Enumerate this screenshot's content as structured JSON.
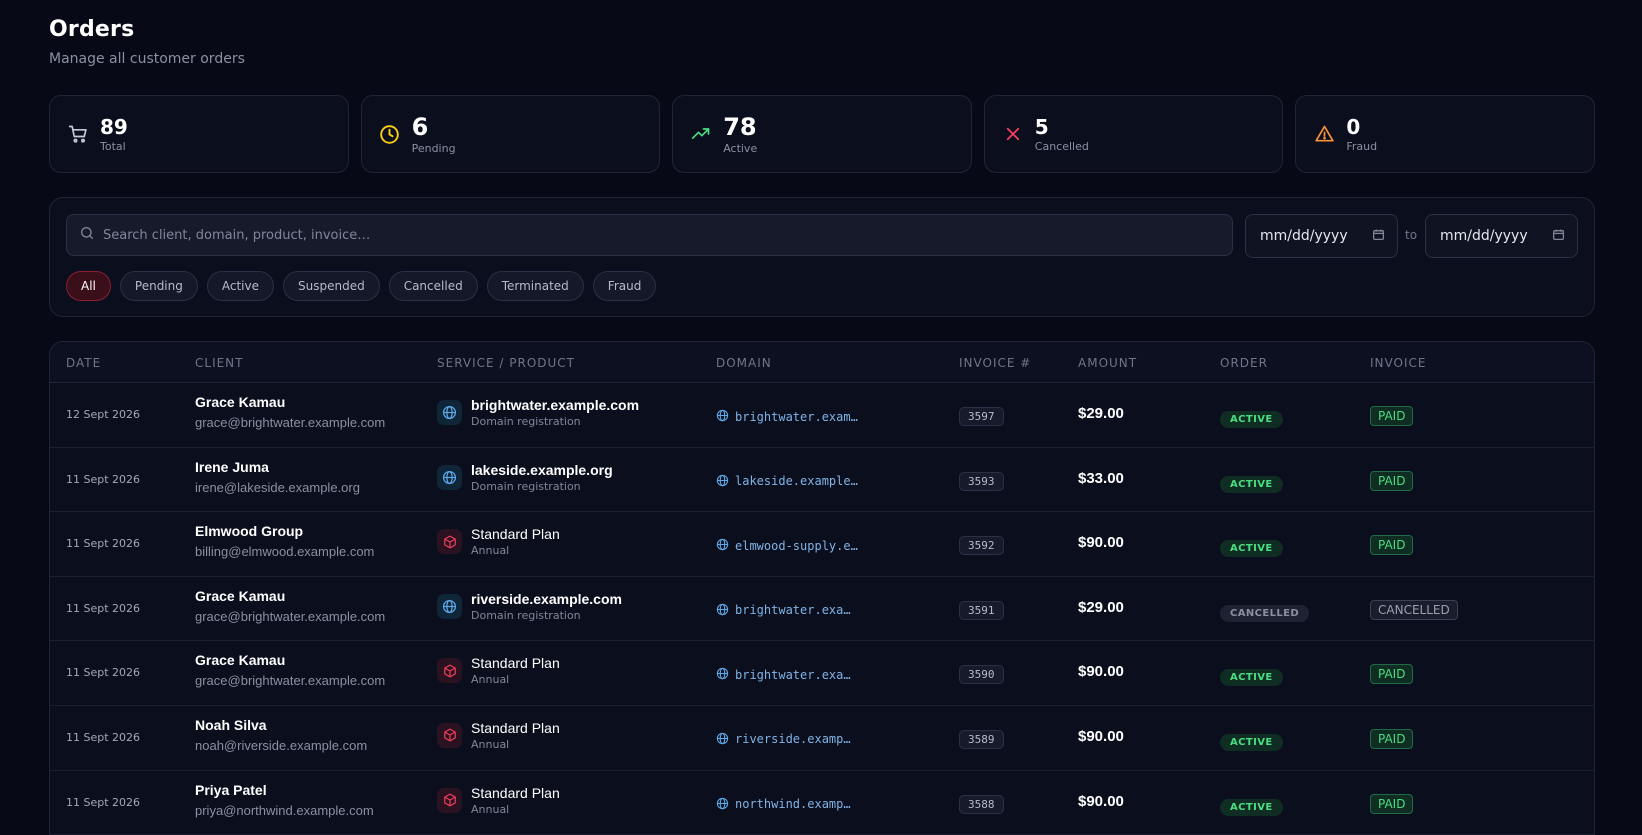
{
  "header": {
    "title": "Orders",
    "subtitle": "Manage all customer orders"
  },
  "stats": [
    {
      "value": "89",
      "label": "Total",
      "icon": "cart-icon",
      "color": "#c7cbd6"
    },
    {
      "value": "6",
      "label": "Pending",
      "icon": "clock-icon",
      "color": "#facc15"
    },
    {
      "value": "78",
      "label": "Active",
      "icon": "trending-up-icon",
      "color": "#4ade80"
    },
    {
      "value": "5",
      "label": "Cancelled",
      "icon": "x-icon",
      "color": "#f43f5e"
    },
    {
      "value": "0",
      "label": "Fraud",
      "icon": "warning-icon",
      "color": "#fb923c"
    }
  ],
  "filters": {
    "search_placeholder": "Search client, domain, product, invoice…",
    "date_from_placeholder": "mm/dd/yyyy",
    "date_to_placeholder": "mm/dd/yyyy",
    "date_separator": "to",
    "chips": [
      "All",
      "Pending",
      "Active",
      "Suspended",
      "Cancelled",
      "Terminated",
      "Fraud"
    ],
    "active_chip": "All"
  },
  "table": {
    "columns": [
      "DATE",
      "CLIENT",
      "SERVICE / PRODUCT",
      "DOMAIN",
      "INVOICE #",
      "AMOUNT",
      "ORDER",
      "INVOICE"
    ],
    "rows": [
      {
        "date": "12 Sept 2026",
        "client": "Grace Kamau",
        "email": "grace@brightwater.example.com",
        "service": "brightwater.example.com",
        "service_sub": "Domain registration",
        "type": "domain",
        "domain": "brightwater.exam…",
        "invoice": "3597",
        "amount": "$29.00",
        "order": "ACTIVE",
        "invoice_status": "PAID"
      },
      {
        "date": "11 Sept 2026",
        "client": "Irene Juma",
        "email": "irene@lakeside.example.org",
        "service": "lakeside.example.org",
        "service_sub": "Domain registration",
        "type": "domain",
        "domain": "lakeside.example…",
        "invoice": "3593",
        "amount": "$33.00",
        "order": "ACTIVE",
        "invoice_status": "PAID"
      },
      {
        "date": "11 Sept 2026",
        "client": "Elmwood Group",
        "email": "billing@elmwood.example.com",
        "service": "Standard Plan",
        "service_sub": "Annual",
        "type": "plan",
        "domain": "elmwood-supply.e…",
        "invoice": "3592",
        "amount": "$90.00",
        "order": "ACTIVE",
        "invoice_status": "PAID"
      },
      {
        "date": "11 Sept 2026",
        "client": "Grace Kamau",
        "email": "grace@brightwater.example.com",
        "service": "riverside.example.com",
        "service_sub": "Domain registration",
        "type": "domain",
        "domain": "brightwater.exa…",
        "invoice": "3591",
        "amount": "$29.00",
        "order": "CANCELLED",
        "invoice_status": "CANCELLED"
      },
      {
        "date": "11 Sept 2026",
        "client": "Grace Kamau",
        "email": "grace@brightwater.example.com",
        "service": "Standard Plan",
        "service_sub": "Annual",
        "type": "plan",
        "domain": "brightwater.exa…",
        "invoice": "3590",
        "amount": "$90.00",
        "order": "ACTIVE",
        "invoice_status": "PAID"
      },
      {
        "date": "11 Sept 2026",
        "client": "Noah Silva",
        "email": "noah@riverside.example.com",
        "service": "Standard Plan",
        "service_sub": "Annual",
        "type": "plan",
        "domain": "riverside.examp…",
        "invoice": "3589",
        "amount": "$90.00",
        "order": "ACTIVE",
        "invoice_status": "PAID"
      },
      {
        "date": "11 Sept 2026",
        "client": "Priya Patel",
        "email": "priya@northwind.example.com",
        "service": "Standard Plan",
        "service_sub": "Annual",
        "type": "plan",
        "domain": "northwind.examp…",
        "invoice": "3588",
        "amount": "$90.00",
        "order": "ACTIVE",
        "invoice_status": "PAID"
      }
    ]
  }
}
